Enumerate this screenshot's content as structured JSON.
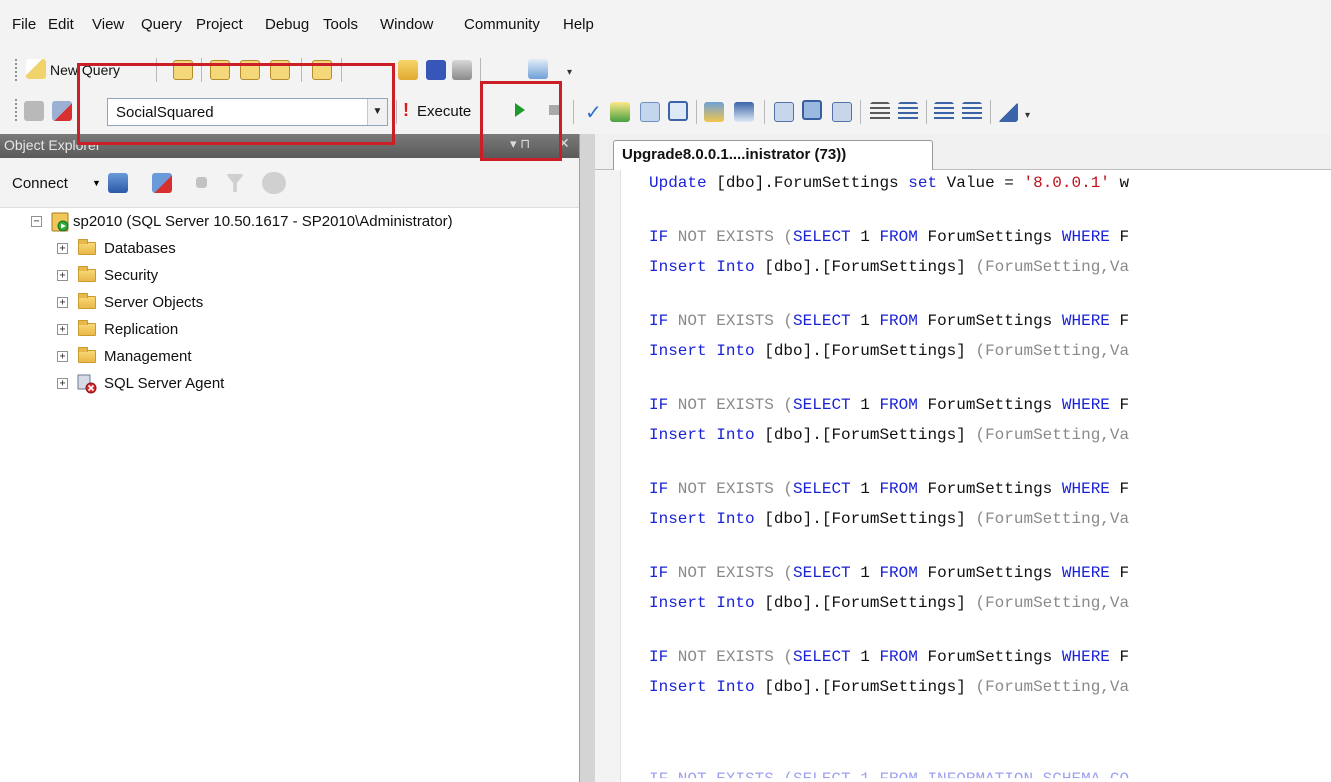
{
  "menu": [
    "File",
    "Edit",
    "View",
    "Query",
    "Project",
    "Debug",
    "Tools",
    "Window",
    "Community",
    "Help"
  ],
  "toolbar": {
    "new_query_label": "New Query",
    "database": "SocialSquared",
    "execute_label": "Execute"
  },
  "object_explorer": {
    "title": "Object Explorer",
    "connect_label": "Connect",
    "server_node": "sp2010 (SQL Server 10.50.1617 - SP2010\\Administrator)",
    "children": [
      "Databases",
      "Security",
      "Server Objects",
      "Replication",
      "Management",
      "SQL Server Agent"
    ]
  },
  "editor": {
    "tab_title": "Upgrade8.0.0.1....inistrator (73))",
    "update_line": {
      "kw1": "Update",
      "mid": " [dbo].ForumSettings ",
      "kw2": "set",
      "mid2": " Value = ",
      "str": "'8.0.0.1'",
      "tail": " w"
    },
    "if_line": {
      "kw1": "IF",
      "gr1": " NOT EXISTS ",
      "paren": "(",
      "kw2": "SELECT",
      "mid": " 1 ",
      "kw3": "FROM",
      "mid2": " ForumSettings ",
      "kw4": "WHERE",
      "tail": " F"
    },
    "insert_line": {
      "kw1": "Insert Into",
      "mid": " [dbo].[ForumSettings] ",
      "paren": "(ForumSetting,Va"
    },
    "partial_line": "IF NOT EXISTS (SELECT 1 FROM INFORMATION_SCHEMA.CO"
  }
}
